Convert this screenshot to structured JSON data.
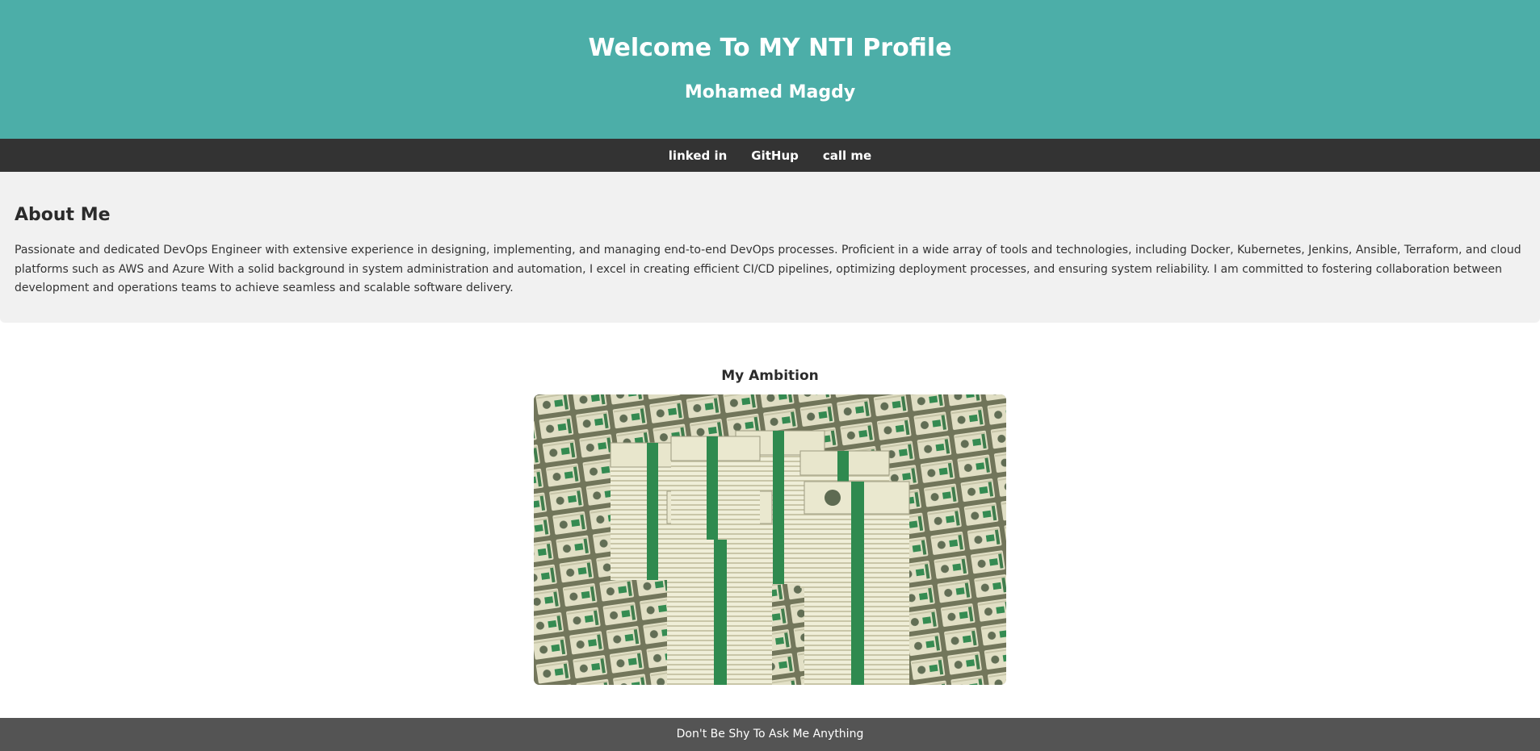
{
  "header": {
    "title": "Welcome To MY NTI Profile",
    "subtitle": "Mohamed Magdy",
    "background_color": "#4caea8"
  },
  "nav": {
    "links": [
      {
        "label": "linked in"
      },
      {
        "label": "GitHup"
      },
      {
        "label": "call me"
      }
    ]
  },
  "about": {
    "heading": "About Me",
    "text": "Passionate and dedicated DevOps Engineer with extensive experience in designing, implementing, and managing end-to-end DevOps processes. Proficient in a wide array of tools and technologies, including Docker, Kubernetes, Jenkins, Ansible, Terraform, and cloud platforms such as AWS and Azure With a solid background in system administration and automation, I excel in creating efficient CI/CD pipelines, optimizing deployment processes, and ensuring system reliability. I am committed to fostering collaboration between development and operations teams to achieve seamless and scalable software delivery."
  },
  "ambition": {
    "heading": "My Ambition",
    "image_description": "stacks of hundred dollar bills"
  },
  "footer": {
    "text": "Don't Be Shy To Ask Me Anything",
    "background_color": "#545454"
  }
}
